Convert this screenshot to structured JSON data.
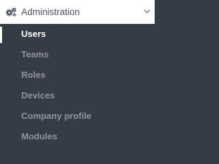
{
  "section": {
    "title": "Administration",
    "icon": "gears-icon",
    "toggle_icon": "chevron-down-icon",
    "expanded": true
  },
  "items": [
    {
      "label": "Users",
      "active": true
    },
    {
      "label": "Teams",
      "active": false
    },
    {
      "label": "Roles",
      "active": false
    },
    {
      "label": "Devices",
      "active": false
    },
    {
      "label": "Company profile",
      "active": false
    },
    {
      "label": "Modules",
      "active": false
    }
  ],
  "colors": {
    "header_background": "#ffffff",
    "menu_background": "#363c46",
    "active_text": "#ffffff",
    "inactive_text": "#8f949c",
    "header_text": "#4a4f57"
  }
}
